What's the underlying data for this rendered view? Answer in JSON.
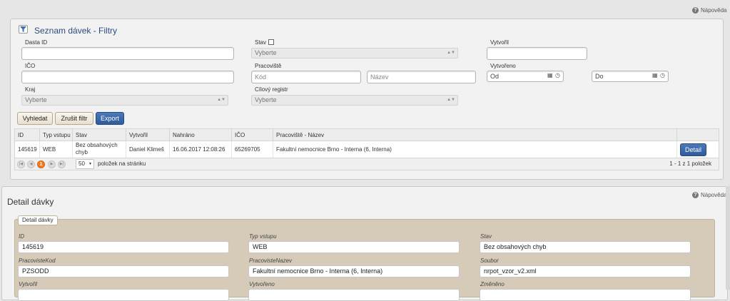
{
  "help_label": "Nápověda",
  "filter": {
    "title": "Seznam dávek - Filtry",
    "fields": {
      "dasta_id": {
        "label": "Dasta ID",
        "value": ""
      },
      "stav": {
        "label": "Stav",
        "selected": "Vyberte"
      },
      "vytvoril": {
        "label": "Vytvořil",
        "value": ""
      },
      "ico": {
        "label": "IČO",
        "value": ""
      },
      "pracoviste": {
        "label": "Pracoviště",
        "kod_placeholder": "Kód",
        "nazev_placeholder": "Název"
      },
      "vytvoreno": {
        "label": "Vytvořeno",
        "od_placeholder": "Od",
        "do_placeholder": "Do"
      },
      "kraj": {
        "label": "Kraj",
        "selected": "Vyberte"
      },
      "cilovy_registr": {
        "label": "Cílový registr",
        "selected": "Vyberte"
      }
    },
    "buttons": {
      "search": "Vyhledat",
      "cancel": "Zrušit filtr",
      "export": "Export"
    }
  },
  "table": {
    "columns": [
      "ID",
      "Typ vstupu",
      "Stav",
      "Vytvořil",
      "Nahráno",
      "IČO",
      "Pracoviště - Název"
    ],
    "rows": [
      {
        "id": "145619",
        "typ": "WEB",
        "stav": "Bez obsahových chyb",
        "vytvoril": "Daniel Klimeš",
        "nahrano": "16.06.2017 12:08:26",
        "ico": "65269705",
        "pracoviste": "Fakultní nemocnice Brno - Interna (6, Interna)",
        "action": "Detail"
      }
    ],
    "pager": {
      "current": "1",
      "page_size": "50",
      "page_size_label": "položek na stránku",
      "summary": "1 - 1 z 1 položek"
    }
  },
  "detail": {
    "title": "Detail dávky",
    "legend": "Detail dávky",
    "fields": [
      {
        "label": "ID",
        "value": "145619"
      },
      {
        "label": "Typ vstupu",
        "value": "WEB"
      },
      {
        "label": "Stav",
        "value": "Bez obsahových chyb"
      },
      {
        "label": "PracovisteKod",
        "value": "PZSODD"
      },
      {
        "label": "PracovisteNazev",
        "value": "Fakultní nemocnice Brno - Interna (6, Interna)"
      },
      {
        "label": "Soubor",
        "value": "nrpot_vzor_v2.xml"
      },
      {
        "label": "Vytvořil",
        "value": ""
      },
      {
        "label": "Vytvořeno",
        "value": ""
      },
      {
        "label": "Změněno",
        "value": ""
      }
    ]
  }
}
